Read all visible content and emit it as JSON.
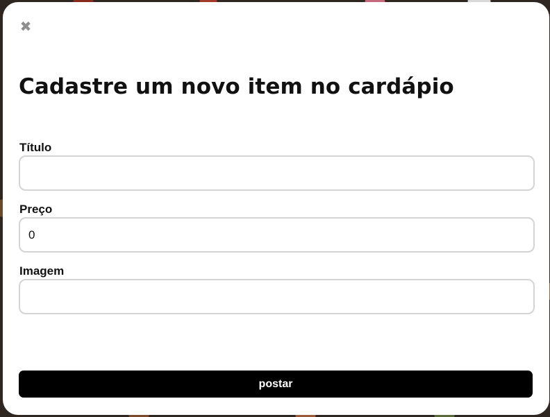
{
  "modal": {
    "close_glyph": "✖",
    "title": "Cadastre um novo item no cardápio",
    "fields": [
      {
        "label": "Título",
        "value": "",
        "placeholder": ""
      },
      {
        "label": "Preço",
        "value": "0",
        "placeholder": ""
      },
      {
        "label": "Imagem",
        "value": "",
        "placeholder": ""
      }
    ],
    "submit_label": "postar"
  },
  "colors": {
    "submit_background": "#000000",
    "submit_text": "#ffffff",
    "input_border": "#d4d4d4",
    "close_icon": "#8f8f8f"
  },
  "icons": {
    "close": "close-icon"
  }
}
